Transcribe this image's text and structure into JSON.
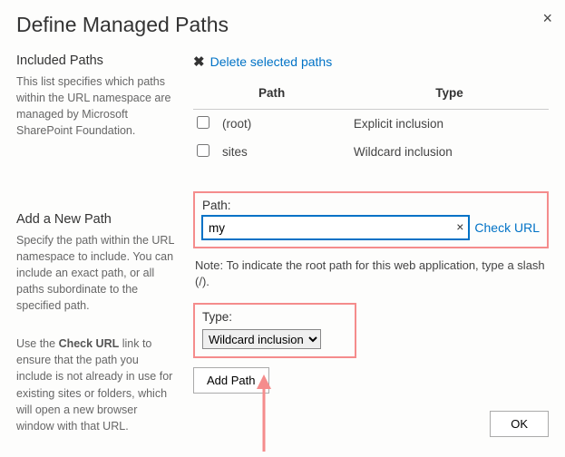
{
  "dialog": {
    "title": "Define Managed Paths"
  },
  "section_included": {
    "heading": "Included Paths",
    "desc": "This list specifies which paths within the URL namespace are managed by Microsoft SharePoint Foundation."
  },
  "delete_link": "Delete selected paths",
  "table": {
    "col_path": "Path",
    "col_type": "Type",
    "rows": [
      {
        "path": "(root)",
        "type": "Explicit inclusion"
      },
      {
        "path": "sites",
        "type": "Wildcard inclusion"
      }
    ]
  },
  "section_add": {
    "heading": "Add a New Path",
    "desc1": "Specify the path within the URL namespace to include. You can include an exact path, or all paths subordinate to the specified path.",
    "desc2_pre": "Use the ",
    "desc2_bold": "Check URL",
    "desc2_post": " link to ensure that the path you include is not already in use for existing sites or folders, which will open a new browser window with that URL."
  },
  "form": {
    "path_label": "Path:",
    "path_value": "my",
    "check_url": "Check URL",
    "note": "Note: To indicate the root path for this web application, type a slash (/).",
    "type_label": "Type:",
    "type_value": "Wildcard inclusion",
    "add_button": "Add Path"
  },
  "ok_button": "OK"
}
